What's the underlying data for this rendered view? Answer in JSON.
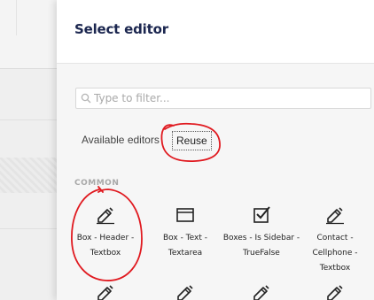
{
  "dialog": {
    "title": "Select editor"
  },
  "filter": {
    "placeholder": "Type to filter..."
  },
  "tabs": [
    {
      "label": "Available editors"
    },
    {
      "label": "Reuse"
    }
  ],
  "section": {
    "label": "COMMON"
  },
  "editors": [
    {
      "label": "Box - Header - Textbox",
      "icon": "pencil-icon"
    },
    {
      "label": "Box - Text - Textarea",
      "icon": "window-icon"
    },
    {
      "label": "Boxes - Is Sidebar - TrueFalse",
      "icon": "checkbox-icon"
    },
    {
      "label": "Contact - Cellphone - Textbox",
      "icon": "pencil-icon"
    },
    {
      "label": "",
      "icon": "pencil-icon"
    },
    {
      "label": "",
      "icon": "pencil-icon"
    },
    {
      "label": "",
      "icon": "pencil-icon"
    },
    {
      "label": "",
      "icon": "pencil-icon"
    }
  ],
  "colors": {
    "title": "#1b264f",
    "annotation": "#e0191f",
    "section_label": "#a8a8a8"
  }
}
